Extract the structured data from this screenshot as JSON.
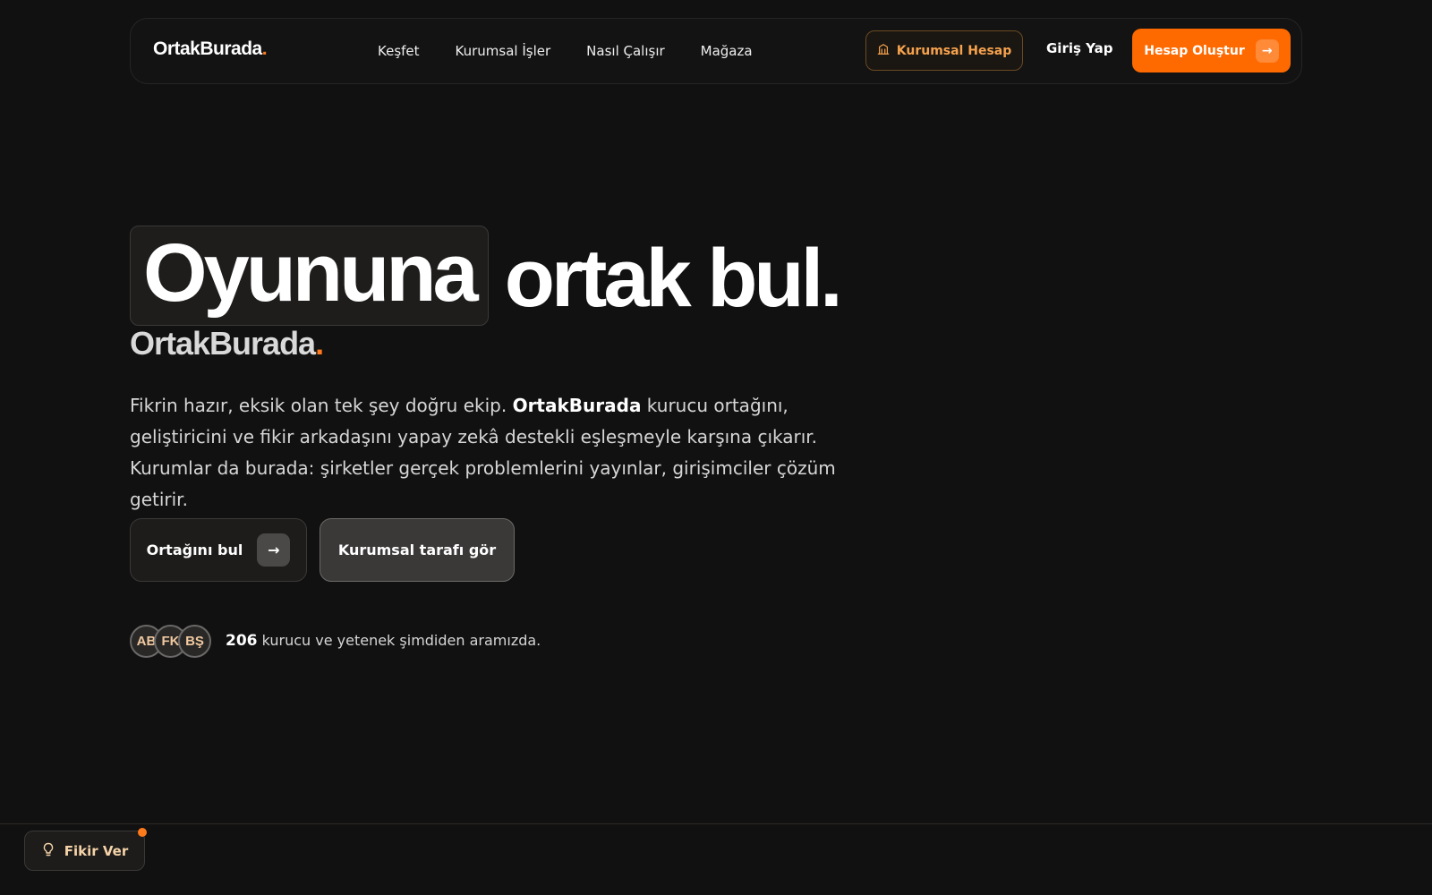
{
  "navbar": {
    "logo_text": "OrtakBurada",
    "logo_dot": ".",
    "links": [
      "Keşfet",
      "Kurumsal İşler",
      "Nasıl Çalışır",
      "Mağaza"
    ],
    "corporate_label": "Kurumsal Hesap",
    "login_label": "Giriş Yap",
    "signup_label": "Hesap Oluştur",
    "signup_arrow": "→"
  },
  "hero": {
    "title_highlight": "Oyununa",
    "title_rest": "ortak bul.",
    "subtitle": "OrtakBurada",
    "subtitle_dot": ".",
    "desc_part1": "Fikrin hazır, eksik olan tek şey doğru ekip. ",
    "desc_brand": "OrtakBurada",
    "desc_part2": " kurucu ortağını, geliştiricini ve fikir arkadaşını yapay zekâ destekli eşleşmeyle karşına çıkarır. Kurumlar da burada: şirketler gerçek problemlerini yayınlar, girişimciler çözüm getirir.",
    "primary_cta": "Ortağını bul",
    "primary_cta_arrow": "→",
    "secondary_cta": "Kurumsal tarafı gör"
  },
  "social_proof": {
    "avatars": [
      "AB",
      "FK",
      "BŞ"
    ],
    "count": "206",
    "text": " kurucu ve yetenek şimdiden aramızda."
  },
  "feedback": {
    "label": "Fikir Ver",
    "icon": "lightbulb-icon"
  },
  "colors": {
    "background": "#121111",
    "accent": "#ff6a00",
    "corporate_text": "#f5a24d"
  }
}
